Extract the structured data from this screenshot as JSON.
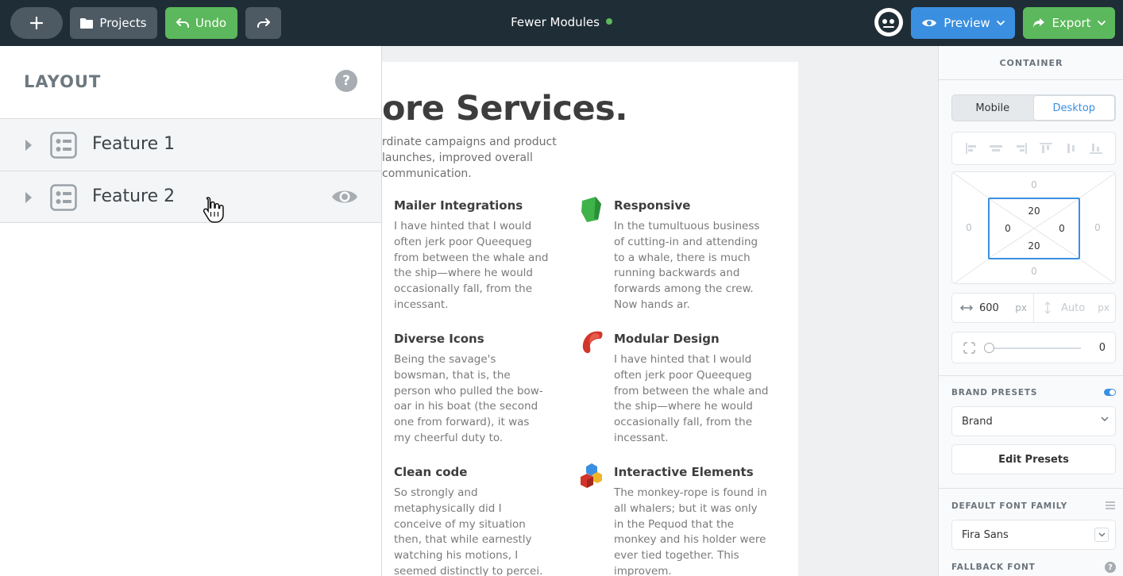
{
  "topbar": {
    "projects_label": "Projects",
    "undo_label": "Undo",
    "document_title": "Fewer Modules",
    "preview_label": "Preview",
    "export_label": "Export",
    "accent_green": "#5cb85c",
    "accent_blue": "#3b8fe0"
  },
  "layout_panel": {
    "title": "LAYOUT",
    "help": "?",
    "items": [
      {
        "label": "Feature 1"
      },
      {
        "label": "Feature 2"
      }
    ]
  },
  "canvas": {
    "hero_title": "ore Services.",
    "hero_subtitle": "rdinate campaigns and product launches, improved overall communication.",
    "features": [
      {
        "title": "Mailer Integrations",
        "body": "I have hinted that I would often jerk poor Queequeg from between the whale and the ship—where he would occasionally fall, from the incessant.",
        "icon": "none"
      },
      {
        "title": "Responsive",
        "body": "In the tumultuous business of cutting-in and attending to a whale, there is much running backwards and forwards among the crew. Now hands ar.",
        "icon": "green-shape-icon"
      },
      {
        "title": "Diverse Icons",
        "body": "Being the savage's bowsman, that is, the person who pulled the bow-oar in his boat (the second one from forward), it was my cheerful duty to.",
        "icon": "none"
      },
      {
        "title": "Modular Design",
        "body": "I have hinted that I would often jerk poor Queequeg from between the whale and the ship—where he would occasionally fall, from the incessant.",
        "icon": "red-shape-icon"
      },
      {
        "title": "Clean code",
        "body": "So strongly and metaphysically did I conceive of my situation then, that while earnestly watching his motions, I seemed distinctly to percei.",
        "icon": "none"
      },
      {
        "title": "Interactive Elements",
        "body": "The monkey-rope is found in all whalers; but it was only in the Pequod that the monkey and his holder were ever tied together. This improvem.",
        "icon": "cubes-icon"
      }
    ]
  },
  "right_panel": {
    "section_title": "CONTAINER",
    "device_tabs": [
      "Mobile",
      "Desktop"
    ],
    "active_device": "Desktop",
    "box_model": {
      "margin_top": "0",
      "margin_right": "0",
      "margin_bottom": "0",
      "margin_left": "0",
      "padding_top": "20",
      "padding_right": "0",
      "padding_bottom": "20",
      "padding_left": "0"
    },
    "width_value": "600",
    "width_unit": "px",
    "height_placeholder": "Auto",
    "height_unit": "px",
    "radius_value": "0",
    "brand_presets_label": "BRAND PRESETS",
    "brand_presets_enabled": true,
    "brand_select_value": "Brand",
    "edit_presets_label": "Edit Presets",
    "default_font_label": "DEFAULT FONT FAMILY",
    "font_select_value": "Fira Sans",
    "fallback_font_label": "FALLBACK FONT"
  }
}
